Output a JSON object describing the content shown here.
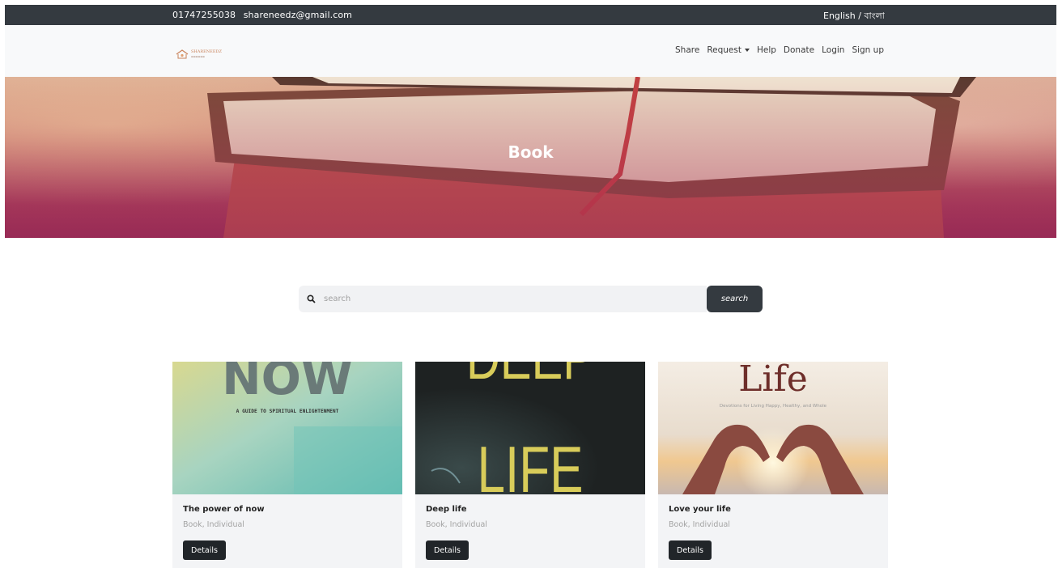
{
  "topbar": {
    "phone": "01747255038",
    "email": "shareneedz@gmail.com",
    "language": "English / বাংলা"
  },
  "navbar": {
    "logo_text": "SHARENEEDZ",
    "links": [
      "Share",
      "Request",
      "Help",
      "Donate",
      "Login",
      "Sign up"
    ]
  },
  "hero": {
    "title": "Book"
  },
  "search": {
    "placeholder": "search",
    "button_label": "search"
  },
  "cards": [
    {
      "title": "The power of now",
      "meta": "Book, Individual",
      "button": "Details",
      "cover_text": "NOW",
      "cover_subtitle": "A GUIDE TO SPIRITUAL ENLIGHTENMENT"
    },
    {
      "title": "Deep life",
      "meta": "Book, Individual",
      "button": "Details",
      "cover_text": "DEEP",
      "cover_text2": "LIFE"
    },
    {
      "title": "Love your life",
      "meta": "Book, Individual",
      "button": "Details",
      "cover_text": "Life",
      "cover_subtitle": "Devotions for Living Happy, Healthy, and Whole"
    }
  ],
  "colors": {
    "dark": "#343a40",
    "light_bg": "#f8f9fa",
    "card_bg": "#f3f4f6"
  }
}
